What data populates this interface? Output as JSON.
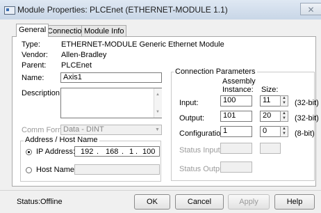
{
  "window": {
    "title": "Module Properties: PLCEnet (ETHERNET-MODULE 1.1)",
    "close_glyph": "✕"
  },
  "tabs": [
    {
      "label": "General",
      "active": true
    },
    {
      "label": "Connection",
      "active": false
    },
    {
      "label": "Module Info",
      "active": false
    }
  ],
  "general": {
    "type_label": "Type:",
    "type_value": "ETHERNET-MODULE Generic Ethernet Module",
    "vendor_label": "Vendor:",
    "vendor_value": "Allen-Bradley",
    "parent_label": "Parent:",
    "parent_value": "PLCEnet",
    "name_label": "Name:",
    "name_value": "Axis1",
    "description_label": "Description:",
    "description_value": "",
    "comm_format_label": "Comm Format:",
    "comm_format_value": "Data - DINT"
  },
  "address_group": {
    "title": "Address / Host Name",
    "ip_label": "IP Address:",
    "ip_octets": [
      "192",
      "168",
      "1",
      "100"
    ],
    "ip_selected": true,
    "host_label": "Host Name:",
    "host_value": ""
  },
  "connection_params": {
    "title": "Connection Parameters",
    "col_instance": "Assembly Instance:",
    "col_size": "Size:",
    "rows": [
      {
        "label": "Input:",
        "instance": "100",
        "size": "11",
        "unit": "(32-bit)"
      },
      {
        "label": "Output:",
        "instance": "101",
        "size": "20",
        "unit": "(32-bit)"
      },
      {
        "label": "Configuration:",
        "instance": "1",
        "size": "0",
        "unit": "(8-bit)"
      }
    ],
    "status_input_label": "Status Input:",
    "status_output_label": "Status Output:"
  },
  "footer": {
    "status_label": "Status:",
    "status_value": "Offline",
    "ok_label": "OK",
    "cancel_label": "Cancel",
    "apply_label": "Apply",
    "help_label": "Help"
  },
  "icons": {
    "window": "module-window-icon",
    "close": "close-icon",
    "spin": "spinner-arrows-icon",
    "dropdown": "chevron-down-icon"
  }
}
